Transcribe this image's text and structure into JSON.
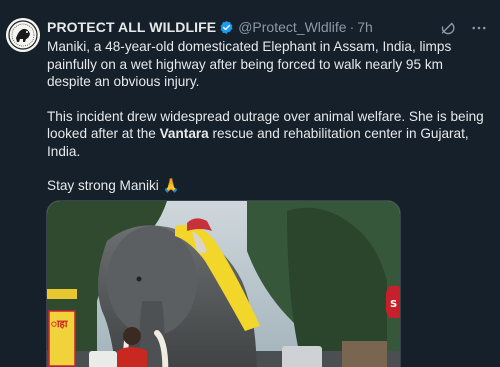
{
  "tweet": {
    "display_name": "PROTECT ALL WILDLIFE",
    "handle": "@Protect_Wldlife",
    "separator": "·",
    "time": "7h",
    "paragraph1": "Maniki, a 48-year-old domesticated Elephant in Assam, India, limps painfully on a wet highway after being forced to walk nearly 95 km despite an obvious injury.",
    "paragraph2_before": "This incident drew widespread outrage over animal welfare. She is being looked after at the ",
    "paragraph2_bold": "Vantara",
    "paragraph2_after": " rescue and rehabilitation center in Gujarat, India.",
    "paragraph3": "Stay strong Maniki 🙏",
    "media_sign_text": "ाहा",
    "media_stop_text": "S"
  },
  "icons": {
    "avatar": "wildlife-logo-icon",
    "verified": "verified-badge-icon",
    "grok": "grok-icon",
    "more": "more-icon"
  },
  "colors": {
    "background": "#15202b",
    "text": "#e7e9ea",
    "secondary": "#8b98a5",
    "verified": "#1d9bf0"
  }
}
